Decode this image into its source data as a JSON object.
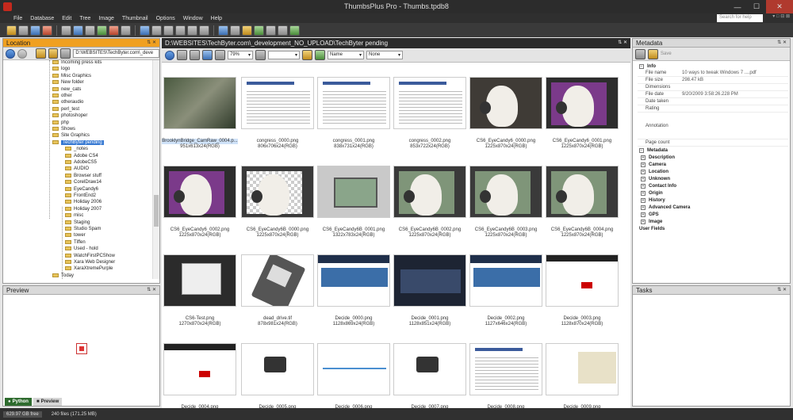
{
  "window": {
    "title": "ThumbsPlus Pro - Thumbs.tpdb8",
    "controls": {
      "minimize": "—",
      "maximize": "☐",
      "close": "✕"
    }
  },
  "menu": [
    "File",
    "Database",
    "Edit",
    "Tree",
    "Image",
    "Thumbnail",
    "Options",
    "Window",
    "Help"
  ],
  "search": {
    "placeholder": "Search for help",
    "extra": "▾ □ ⊟ ⊠"
  },
  "location": {
    "title": "Location",
    "path": "D:\\WEBSITES\\TechByter.com\\_deve",
    "tree": [
      "Incoming press kits",
      "logo",
      "Misc Graphics",
      "New folder",
      "new_cats",
      "other",
      "otheraudio",
      "perl_test",
      "photoshoper",
      "php",
      "Shows",
      "Site Graphics",
      "TechByter pending",
      "_notes",
      "Adobe CS4",
      "AdobeCS5",
      "AUDIO",
      "Browser stuff",
      "CorelDraw14",
      "EyeCandy6",
      "FrontEnd2",
      "Holiday 2006",
      "Holiday 2007",
      "misc",
      "Staging",
      "Studio Spam",
      "tower",
      "Tiffen",
      "Used - hold",
      "WatchFirstPCShow",
      "Xara Web Designer",
      "XaraXtremePurple",
      "Today"
    ]
  },
  "preview": {
    "title": "Preview"
  },
  "tabs": [
    {
      "label": "Python"
    },
    {
      "label": "Preview"
    }
  ],
  "status": {
    "free": "629.97 GB free",
    "files": "240 files (171.25 MB)"
  },
  "main": {
    "path": "D:\\WEBSITES\\TechByter.com\\_development_NO_UPLOAD\\TechByter pending",
    "zoom": "79%",
    "sort1": "Name",
    "sort2": "None",
    "thumbs": [
      {
        "name": "BrooklynBridge_CamRaw_0004.p...",
        "info": "951x613x24(RGB)",
        "kind": "photo"
      },
      {
        "name": "congress_0000.png",
        "info": "806x706x24(RGB)",
        "kind": "doc"
      },
      {
        "name": "congress_0001.png",
        "info": "838x731x24(RGB)",
        "kind": "doc"
      },
      {
        "name": "congress_0002.png",
        "info": "853x722x24(RGB)",
        "kind": "doc"
      },
      {
        "name": "CS6_EyeCandy6_0000.png",
        "info": "1225x870x24(RGB)",
        "kind": "bird"
      },
      {
        "name": "CS6_EyeCandy6_0001.png",
        "info": "1225x870x24(RGB)",
        "kind": "birdp"
      },
      {
        "name": "CS6_EyeCandy6_0002.png",
        "info": "1225x870x24(RGB)",
        "kind": "birdp"
      },
      {
        "name": "CS6_EyeCandy6B_0000.png",
        "info": "1225x870x24(RGB)",
        "kind": "birdc"
      },
      {
        "name": "CS6_EyeCandy6B_0001.png",
        "info": "1322x783x24(RGB)",
        "kind": "stone"
      },
      {
        "name": "CS6_EyeCandy6B_0002.png",
        "info": "1225x870x24(RGB)",
        "kind": "birds"
      },
      {
        "name": "CS6_EyeCandy6B_0003.png",
        "info": "1225x870x24(RGB)",
        "kind": "birds"
      },
      {
        "name": "CS6_EyeCandy6B_0004.png",
        "info": "1225x870x24(RGB)",
        "kind": "birds"
      },
      {
        "name": "CS6-Test.png",
        "info": "1270x870x24(RGB)",
        "kind": "dialog"
      },
      {
        "name": "dead_drive.tif",
        "info": "878x981x24(RGB)",
        "kind": "drive"
      },
      {
        "name": "Decide_0000.png",
        "info": "1128x869x24(RGB)",
        "kind": "web"
      },
      {
        "name": "Decide_0001.png",
        "info": "1128x851x24(RGB)",
        "kind": "webd"
      },
      {
        "name": "Decide_0002.png",
        "info": "1127x646x24(RGB)",
        "kind": "web"
      },
      {
        "name": "Decide_0003.png",
        "info": "1128x870x24(RGB)",
        "kind": "webr"
      },
      {
        "name": "Decide_0004.png",
        "info": "",
        "kind": "webr"
      },
      {
        "name": "Decide_0005.png",
        "info": "",
        "kind": "cam"
      },
      {
        "name": "Decide_0006.png",
        "info": "",
        "kind": "chart"
      },
      {
        "name": "Decide_0007.png",
        "info": "",
        "kind": "cam"
      },
      {
        "name": "Decide_0008.png",
        "info": "",
        "kind": "doc"
      },
      {
        "name": "Decide_0009.png",
        "info": "",
        "kind": "map"
      }
    ]
  },
  "metadata": {
    "title": "Metadata",
    "save": "Save",
    "info_header": "Info",
    "rows": [
      {
        "k": "File name",
        "v": "10 ways to tweak Windows 7 ....pdf"
      },
      {
        "k": "File size",
        "v": "298.47 kB"
      },
      {
        "k": "Dimensions",
        "v": ""
      },
      {
        "k": "File date",
        "v": "9/20/2009  3:58:26.228 PM"
      },
      {
        "k": "Date taken",
        "v": ""
      },
      {
        "k": "Rating",
        "v": ""
      },
      {
        "k": "Annotation",
        "v": ""
      },
      {
        "k": "Page count",
        "v": ""
      }
    ],
    "meta_header": "Metadata",
    "categories": [
      "Description",
      "Camera",
      "Location",
      "Unknown",
      "Contact Info",
      "Origin",
      "History",
      "Advanced Camera",
      "GPS",
      "Image"
    ],
    "user_fields": "User Fields"
  },
  "tasks": {
    "title": "Tasks"
  },
  "panel_ctl": "⇅ ✕"
}
